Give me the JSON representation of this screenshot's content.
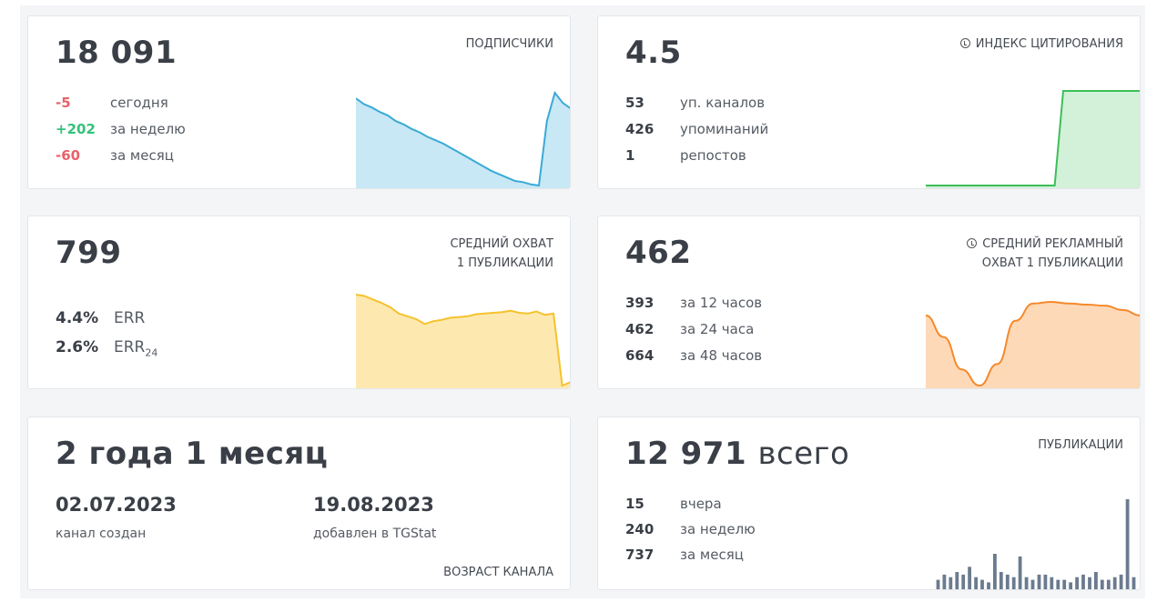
{
  "cards": {
    "subscribers": {
      "value": "18 091",
      "label": "ПОДПИСЧИКИ",
      "stats": [
        {
          "value": "-5",
          "text": "сегодня"
        },
        {
          "value": "+202",
          "text": "за неделю"
        },
        {
          "value": "-60",
          "text": "за месяц"
        }
      ]
    },
    "citation": {
      "value": "4.5",
      "label": "ИНДЕКС ЦИТИРОВАНИЯ",
      "icon": "clock-icon",
      "stats": [
        {
          "value": "53",
          "text": "уп. каналов"
        },
        {
          "value": "426",
          "text": "упоминаний"
        },
        {
          "value": "1",
          "text": "репостов"
        }
      ]
    },
    "reach": {
      "value": "799",
      "label_line1": "СРЕДНИЙ ОХВАТ",
      "label_line2": "1 ПУБЛИКАЦИИ",
      "err": [
        {
          "value": "4.4%",
          "text": "ERR",
          "sub": ""
        },
        {
          "value": "2.6%",
          "text": "ERR",
          "sub": "24"
        }
      ]
    },
    "ad_reach": {
      "value": "462",
      "label_line1": "СРЕДНИЙ РЕКЛАМНЫЙ",
      "label_line2": "ОХВАТ 1 ПУБЛИКАЦИИ",
      "icon": "clock-icon",
      "stats": [
        {
          "value": "393",
          "text": "за 12 часов"
        },
        {
          "value": "462",
          "text": "за 24 часа"
        },
        {
          "value": "664",
          "text": "за 48 часов"
        }
      ]
    },
    "age": {
      "value": "2 года 1 месяц",
      "created_date": "02.07.2023",
      "created_caption": "канал создан",
      "added_date": "19.08.2023",
      "added_caption": "добавлен в TGStat",
      "label": "ВОЗРАСТ КАНАЛА"
    },
    "posts": {
      "value": "12 971",
      "suffix": "всего",
      "label": "ПУБЛИКАЦИИ",
      "stats": [
        {
          "value": "15",
          "text": "вчера"
        },
        {
          "value": "240",
          "text": "за неделю"
        },
        {
          "value": "737",
          "text": "за месяц"
        }
      ]
    }
  },
  "colors": {
    "negative": "#e8626a",
    "positive": "#33c27a",
    "subscribers_line": "#3aaad6",
    "citation_line": "#3cbf5a",
    "reach_line": "#f5c22e",
    "ad_line": "#f5892a",
    "bars": "#6b7b8f"
  },
  "sparklines": {
    "subscribers": [
      18120,
      18115,
      18112,
      18108,
      18105,
      18100,
      18097,
      18093,
      18090,
      18086,
      18083,
      18080,
      18076,
      18072,
      18068,
      18064,
      18060,
      18056,
      18053,
      18050,
      18047,
      18046,
      18044,
      18043,
      18100,
      18125,
      18116,
      18111
    ],
    "citation": [
      0,
      0,
      0,
      0,
      0,
      0,
      0,
      0,
      0,
      0,
      0,
      0,
      0,
      0,
      0,
      0,
      4.5,
      4.5,
      4.5,
      4.5,
      4.5,
      4.5,
      4.5,
      4.5,
      4.5,
      4.5
    ],
    "reach": [
      805,
      803,
      798,
      793,
      787,
      778,
      774,
      770,
      763,
      767,
      769,
      772,
      773,
      774,
      777,
      778,
      779,
      780,
      782,
      779,
      778,
      781,
      776,
      778,
      675,
      680
    ],
    "ad_reach": [
      430,
      390,
      330,
      300,
      340,
      420,
      452,
      455,
      452,
      450,
      448,
      440,
      430
    ],
    "posts": [
      4,
      6,
      5,
      7,
      6,
      9,
      5,
      4,
      3,
      14,
      7,
      6,
      5,
      13,
      5,
      4,
      6,
      6,
      5,
      4,
      4,
      3,
      5,
      6,
      5,
      7,
      4,
      4,
      5,
      6,
      35,
      5
    ]
  }
}
